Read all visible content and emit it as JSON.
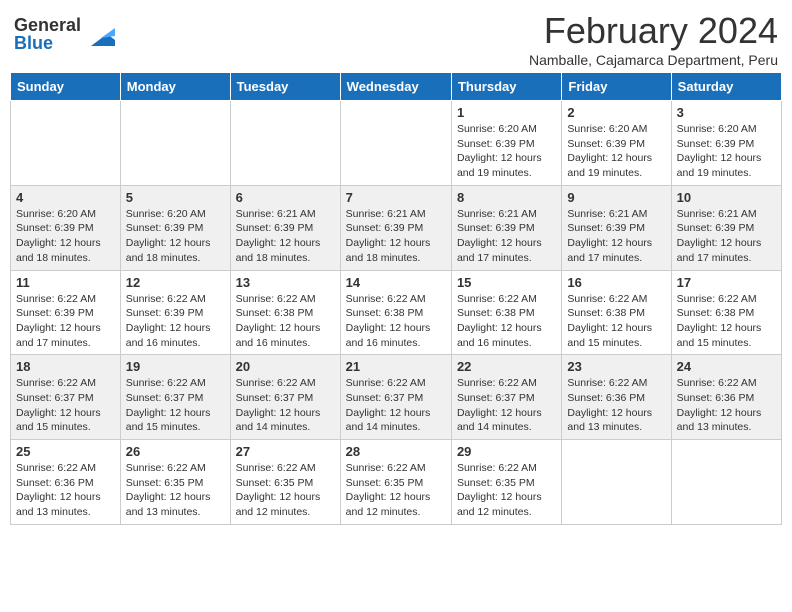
{
  "logo": {
    "general": "General",
    "blue": "Blue"
  },
  "title": {
    "month_year": "February 2024",
    "location": "Namballe, Cajamarca Department, Peru"
  },
  "days_of_week": [
    "Sunday",
    "Monday",
    "Tuesday",
    "Wednesday",
    "Thursday",
    "Friday",
    "Saturday"
  ],
  "weeks": [
    [
      {
        "day": "",
        "info": ""
      },
      {
        "day": "",
        "info": ""
      },
      {
        "day": "",
        "info": ""
      },
      {
        "day": "",
        "info": ""
      },
      {
        "day": "1",
        "info": "Sunrise: 6:20 AM\nSunset: 6:39 PM\nDaylight: 12 hours and 19 minutes."
      },
      {
        "day": "2",
        "info": "Sunrise: 6:20 AM\nSunset: 6:39 PM\nDaylight: 12 hours and 19 minutes."
      },
      {
        "day": "3",
        "info": "Sunrise: 6:20 AM\nSunset: 6:39 PM\nDaylight: 12 hours and 19 minutes."
      }
    ],
    [
      {
        "day": "4",
        "info": "Sunrise: 6:20 AM\nSunset: 6:39 PM\nDaylight: 12 hours and 18 minutes."
      },
      {
        "day": "5",
        "info": "Sunrise: 6:20 AM\nSunset: 6:39 PM\nDaylight: 12 hours and 18 minutes."
      },
      {
        "day": "6",
        "info": "Sunrise: 6:21 AM\nSunset: 6:39 PM\nDaylight: 12 hours and 18 minutes."
      },
      {
        "day": "7",
        "info": "Sunrise: 6:21 AM\nSunset: 6:39 PM\nDaylight: 12 hours and 18 minutes."
      },
      {
        "day": "8",
        "info": "Sunrise: 6:21 AM\nSunset: 6:39 PM\nDaylight: 12 hours and 17 minutes."
      },
      {
        "day": "9",
        "info": "Sunrise: 6:21 AM\nSunset: 6:39 PM\nDaylight: 12 hours and 17 minutes."
      },
      {
        "day": "10",
        "info": "Sunrise: 6:21 AM\nSunset: 6:39 PM\nDaylight: 12 hours and 17 minutes."
      }
    ],
    [
      {
        "day": "11",
        "info": "Sunrise: 6:22 AM\nSunset: 6:39 PM\nDaylight: 12 hours and 17 minutes."
      },
      {
        "day": "12",
        "info": "Sunrise: 6:22 AM\nSunset: 6:39 PM\nDaylight: 12 hours and 16 minutes."
      },
      {
        "day": "13",
        "info": "Sunrise: 6:22 AM\nSunset: 6:38 PM\nDaylight: 12 hours and 16 minutes."
      },
      {
        "day": "14",
        "info": "Sunrise: 6:22 AM\nSunset: 6:38 PM\nDaylight: 12 hours and 16 minutes."
      },
      {
        "day": "15",
        "info": "Sunrise: 6:22 AM\nSunset: 6:38 PM\nDaylight: 12 hours and 16 minutes."
      },
      {
        "day": "16",
        "info": "Sunrise: 6:22 AM\nSunset: 6:38 PM\nDaylight: 12 hours and 15 minutes."
      },
      {
        "day": "17",
        "info": "Sunrise: 6:22 AM\nSunset: 6:38 PM\nDaylight: 12 hours and 15 minutes."
      }
    ],
    [
      {
        "day": "18",
        "info": "Sunrise: 6:22 AM\nSunset: 6:37 PM\nDaylight: 12 hours and 15 minutes."
      },
      {
        "day": "19",
        "info": "Sunrise: 6:22 AM\nSunset: 6:37 PM\nDaylight: 12 hours and 15 minutes."
      },
      {
        "day": "20",
        "info": "Sunrise: 6:22 AM\nSunset: 6:37 PM\nDaylight: 12 hours and 14 minutes."
      },
      {
        "day": "21",
        "info": "Sunrise: 6:22 AM\nSunset: 6:37 PM\nDaylight: 12 hours and 14 minutes."
      },
      {
        "day": "22",
        "info": "Sunrise: 6:22 AM\nSunset: 6:37 PM\nDaylight: 12 hours and 14 minutes."
      },
      {
        "day": "23",
        "info": "Sunrise: 6:22 AM\nSunset: 6:36 PM\nDaylight: 12 hours and 13 minutes."
      },
      {
        "day": "24",
        "info": "Sunrise: 6:22 AM\nSunset: 6:36 PM\nDaylight: 12 hours and 13 minutes."
      }
    ],
    [
      {
        "day": "25",
        "info": "Sunrise: 6:22 AM\nSunset: 6:36 PM\nDaylight: 12 hours and 13 minutes."
      },
      {
        "day": "26",
        "info": "Sunrise: 6:22 AM\nSunset: 6:35 PM\nDaylight: 12 hours and 13 minutes."
      },
      {
        "day": "27",
        "info": "Sunrise: 6:22 AM\nSunset: 6:35 PM\nDaylight: 12 hours and 12 minutes."
      },
      {
        "day": "28",
        "info": "Sunrise: 6:22 AM\nSunset: 6:35 PM\nDaylight: 12 hours and 12 minutes."
      },
      {
        "day": "29",
        "info": "Sunrise: 6:22 AM\nSunset: 6:35 PM\nDaylight: 12 hours and 12 minutes."
      },
      {
        "day": "",
        "info": ""
      },
      {
        "day": "",
        "info": ""
      }
    ]
  ]
}
